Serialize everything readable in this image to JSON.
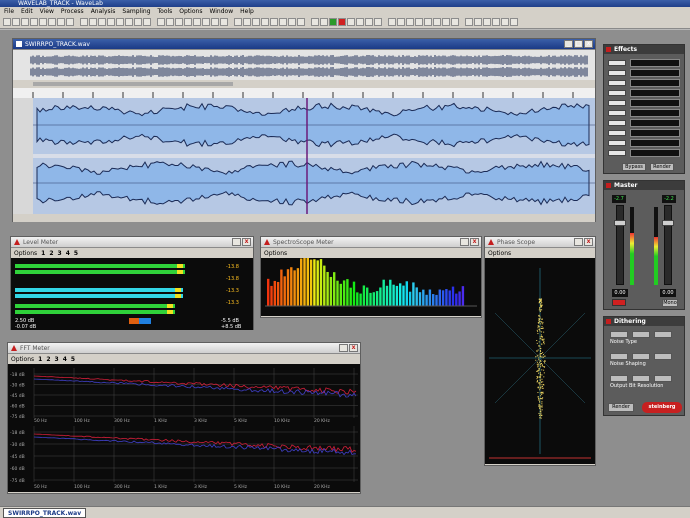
{
  "app": {
    "title": "WAVELAB_TRACK - WaveLab"
  },
  "menu": [
    "File",
    "Edit",
    "View",
    "Process",
    "Analysis",
    "Sampling",
    "Tools",
    "Options",
    "Window",
    "Help"
  ],
  "wave_window": {
    "title": "SWIRRPO_TRACK.wav"
  },
  "level_meter": {
    "title": "Level Meter",
    "options_label": "Options",
    "presets": [
      "1",
      "2",
      "3",
      "4",
      "5"
    ],
    "left_labels": [
      "2.50 dB",
      "-0.07 dB"
    ],
    "right_labels": [
      "-5.5 dB",
      "+8.5 dB"
    ],
    "readouts": [
      "-13.8",
      "-13.8",
      "-13.3",
      "-13.3"
    ]
  },
  "spectrum": {
    "title": "SpectroScope Meter",
    "options_label": "Options"
  },
  "phase": {
    "title": "Phase Scope",
    "options_label": "Options"
  },
  "fft": {
    "title": "FFT Meter",
    "options_label": "Options",
    "presets": [
      "1",
      "2",
      "3",
      "4",
      "5"
    ],
    "y_labels_top": [
      "-18 dB",
      "-30 dB",
      "-45 dB",
      "-60 dB",
      "-75 dB"
    ],
    "y_labels_bottom": [
      "-18 dB",
      "-30 dB",
      "-45 dB",
      "-60 dB",
      "-75 dB"
    ],
    "x_labels": [
      "50 Hz",
      "100 Hz",
      "300 Hz",
      "1 KHz",
      "3 KHz",
      "5 KHz",
      "10 KHz",
      "20 KHz"
    ]
  },
  "effects": {
    "title": "Effects",
    "buttons": [
      "Bypass",
      "Render"
    ]
  },
  "master": {
    "title": "Master",
    "left_value": "-2.7",
    "right_value": "-2.2",
    "left_peak": "0.00",
    "right_peak": "0.00",
    "mode_label": "Mono"
  },
  "dithering": {
    "title": "Dithering",
    "labels": [
      "Noise Type",
      "Noise Shaping",
      "Output Bit Resolution"
    ],
    "render_label": "Render",
    "brand": "steinberg"
  },
  "status": {
    "tab_label": "SWIRRPO_TRACK.wav"
  },
  "colors": {
    "wave_bg": "#b6c8e4",
    "wave_fill": "#8fb7e8",
    "wave_line": "#1a2a55",
    "meter_green": "#2fd13a",
    "meter_cyan": "#33d6e6",
    "fft_red": "#d21f3a",
    "fft_blue": "#4040c8"
  }
}
